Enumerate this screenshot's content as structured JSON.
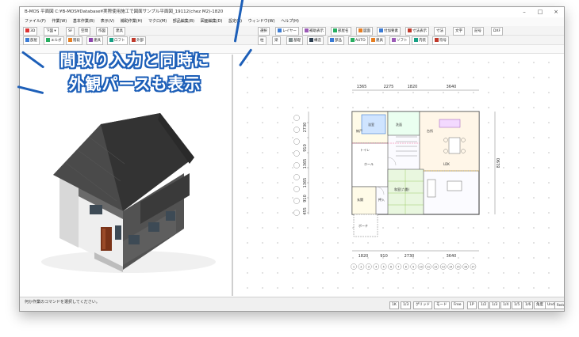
{
  "window": {
    "title": "B-MOS 平面図 C:¥B-MOS¥Database¥実際使用施工で図面サンプル平面図_19112(chez M2)-1820"
  },
  "menu": [
    "ファイル(F)",
    "作業(W)",
    "基本作業(B)",
    "表示(V)",
    "補助作業(H)",
    "マクロ(M)",
    "部品編集(B)",
    "図面編集(D)",
    "設定(S)",
    "ウィンドウ(W)",
    "ヘルプ(H)"
  ],
  "toolbar_left": {
    "button_3d": "3D",
    "view_select": "下図",
    "b1": "SF",
    "b2": "空間",
    "b3": "作図",
    "b4": "建具"
  },
  "toolbar_right": [
    "選択",
    "レイヤー",
    "補助表示",
    "部屋名",
    "図面",
    "付加要素",
    "寸法表示",
    "寸法",
    "文字",
    "記号",
    "DXF"
  ],
  "toolbar2": [
    "部屋",
    "エルボ",
    "階段",
    "建具",
    "ロフト",
    "外部",
    "柱",
    "梁",
    "基礎",
    "構造",
    "部品",
    "AUTO",
    "建具",
    "ソフト",
    "内装",
    "符号"
  ],
  "callout": {
    "line1": "間取り入力と同時に",
    "line2": "外観パースも表示"
  },
  "plan": {
    "top_dims": [
      "1365",
      "2275",
      "1820",
      "3640"
    ],
    "bottom_dims": [
      "1820",
      "910",
      "2730",
      "3640"
    ],
    "left_dims": [
      "2730",
      "910",
      "1365",
      "1365",
      "910",
      "455"
    ],
    "right_dim": "8190",
    "rooms": [
      "納戸",
      "浴室",
      "洗面",
      "トイレ",
      "ホール",
      "LDK",
      "和室(六畳)",
      "玄関",
      "ポーチ",
      "押入",
      "台所"
    ],
    "grid_numbers": [
      "1",
      "2",
      "3",
      "4",
      "5",
      "6",
      "7",
      "8",
      "9",
      "10",
      "11",
      "12",
      "13",
      "14",
      "15",
      "16",
      "17"
    ]
  },
  "status": {
    "message": "何か作業のコマンドを選択してください。",
    "buttons": [
      "1K",
      "1/3",
      "グリッド",
      "モード",
      "Free",
      "1P",
      "1/2",
      "1/3",
      "1/4",
      "1/5",
      "1/6",
      "角度",
      "Undo",
      "Redo"
    ]
  },
  "colors": {
    "accent": "#1d5fb8",
    "roof": "#3a3a3a",
    "wall_light": "#e6e6e6",
    "wall_dark": "#4a4a4a",
    "door": "#7a3318"
  }
}
